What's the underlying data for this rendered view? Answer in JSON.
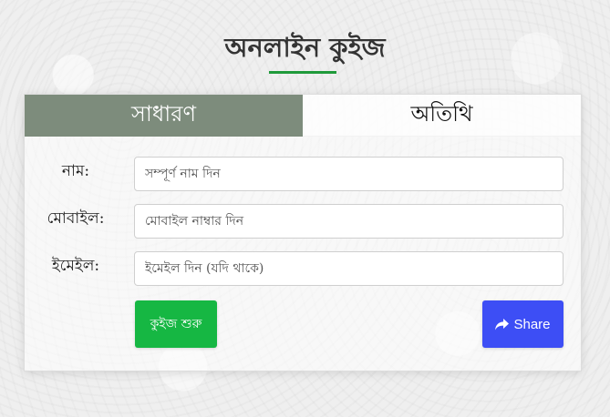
{
  "title": "অনলাইন কুইজ",
  "tabs": [
    {
      "label": "সাধারণ",
      "active": true
    },
    {
      "label": "অতিথি",
      "active": false
    }
  ],
  "form": {
    "name": {
      "label": "নাম:",
      "value": "",
      "placeholder": "সম্পূর্ণ নাম দিন"
    },
    "mobile": {
      "label": "মোবাইল:",
      "value": "",
      "placeholder": "মোবাইল নাম্বার দিন"
    },
    "email": {
      "label": "ইমেইল:",
      "value": "",
      "placeholder": "ইমেইল দিন (যদি থাকে)"
    }
  },
  "buttons": {
    "start_label": "কুইজ শুরু",
    "share_label": "Share",
    "share_icon": "share-icon"
  },
  "colors": {
    "accent_green": "#16b743",
    "title_underline": "#1f9a3a",
    "active_tab": "#7d8c7c",
    "share_blue": "#3d4ef5"
  }
}
